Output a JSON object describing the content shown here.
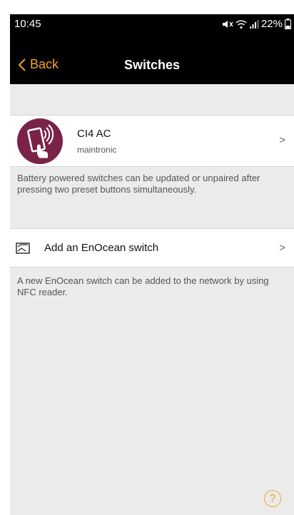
{
  "status_bar": {
    "time": "10:45",
    "battery": "22%"
  },
  "nav": {
    "back_label": "Back",
    "title": "Switches"
  },
  "device": {
    "name": "CI4 AC",
    "subtitle": "maintronic",
    "icon": "touch-phone-icon"
  },
  "notes": {
    "battery_note": "Battery powered switches can be updated or unpaired after pressing two preset buttons simultaneously.",
    "enocean_note": "A new EnOcean switch can be added to the network by using NFC reader."
  },
  "add_switch": {
    "label": "Add an EnOcean switch",
    "icon": "switch-icon"
  },
  "colors": {
    "accent": "#f3a32b",
    "avatar": "#7a2348",
    "background": "#ebebeb"
  }
}
